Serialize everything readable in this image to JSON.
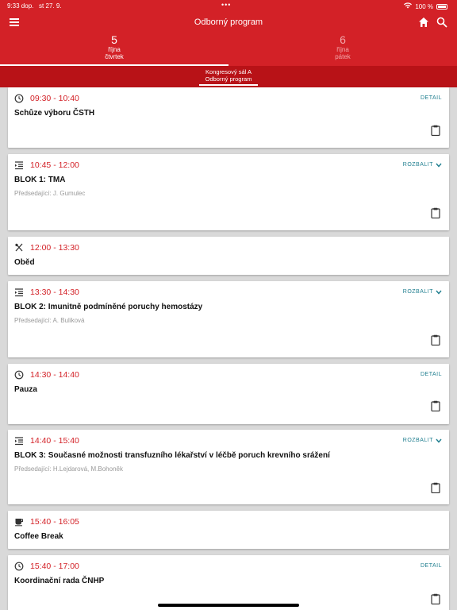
{
  "status": {
    "time": "9:33 dop.",
    "date": "st 27. 9.",
    "dots": "•••",
    "battery": "100 %"
  },
  "header": {
    "title": "Odborný program"
  },
  "days": [
    {
      "num": "5",
      "month": "října",
      "name": "čtvrtek"
    },
    {
      "num": "6",
      "month": "října",
      "name": "pátek"
    }
  ],
  "room": {
    "line1": "Kongresový sál A",
    "line2": "Odborný program"
  },
  "sessions": [
    {
      "time": "09:30 - 10:40",
      "title": "Schůze výboru ČSTH",
      "action": "DETAIL"
    },
    {
      "time": "10:45 - 12:00",
      "title": "BLOK 1: TMA",
      "chairs": "Předsedající: J. Gumulec",
      "action": "ROZBALIT"
    },
    {
      "time": "12:00 - 13:30",
      "title": "Oběd"
    },
    {
      "time": "13:30 - 14:30",
      "title": "BLOK 2: Imunitně podmíněné poruchy hemostázy",
      "chairs": "Předsedající: A. Buliková",
      "action": "ROZBALIT"
    },
    {
      "time": "14:30 - 14:40",
      "title": "Pauza",
      "action": "DETAIL"
    },
    {
      "time": "14:40 - 15:40",
      "title": "BLOK 3: Současné možnosti transfuzního lékařství v léčbě poruch krevního srážení",
      "chairs": "Předsedající: H.Lejdarová, M.Bohoněk",
      "action": "ROZBALIT"
    },
    {
      "time": "15:40 - 16:05",
      "title": "Coffee Break"
    },
    {
      "time": "15:40 - 17:00",
      "title": "Koordinační rada ČNHP",
      "action": "DETAIL"
    }
  ],
  "colors": {
    "primary": "#d32127",
    "dark": "#b81217",
    "link": "#1f7e8f"
  }
}
